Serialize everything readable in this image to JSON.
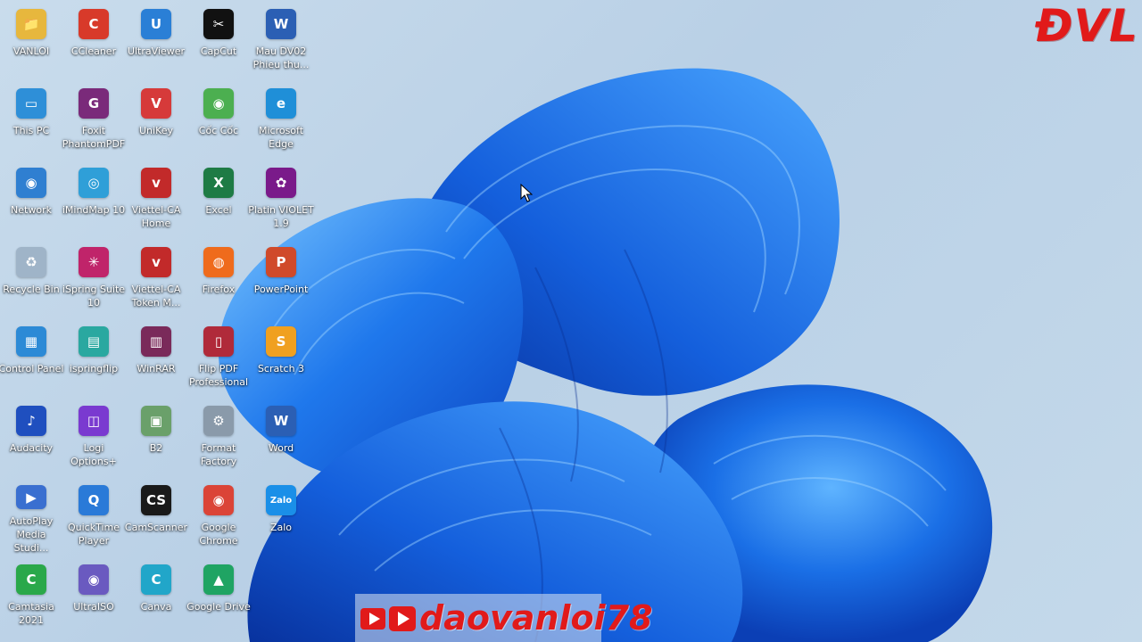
{
  "desktop": {
    "icons": [
      {
        "label": "VANLOI",
        "glyph": "📁",
        "color": "#e7b73d"
      },
      {
        "label": "This PC",
        "glyph": "▭",
        "color": "#2e8fd8"
      },
      {
        "label": "Network",
        "glyph": "◉",
        "color": "#2f7fd1"
      },
      {
        "label": "Recycle Bin",
        "glyph": "♻",
        "color": "#9fb4c8"
      },
      {
        "label": "Control Panel",
        "glyph": "▦",
        "color": "#2c8ad6"
      },
      {
        "label": "Audacity",
        "glyph": "♪",
        "color": "#1f4fbf"
      },
      {
        "label": "AutoPlay Media Studi...",
        "glyph": "▶",
        "color": "#3a6fd0"
      },
      {
        "label": "Camtasia 2021",
        "glyph": "C",
        "color": "#2aa84a"
      },
      {
        "label": "CCleaner",
        "glyph": "C",
        "color": "#d83a2a"
      },
      {
        "label": "Foxit PhantomPDF",
        "glyph": "G",
        "color": "#7a2a7a"
      },
      {
        "label": "iMindMap 10",
        "glyph": "◎",
        "color": "#2f9fd8"
      },
      {
        "label": "iSpring Suite 10",
        "glyph": "✳",
        "color": "#c0246a"
      },
      {
        "label": "ispringflip",
        "glyph": "▤",
        "color": "#2aa8a0"
      },
      {
        "label": "Logi Options+",
        "glyph": "◫",
        "color": "#7a3ad0"
      },
      {
        "label": "QuickTime Player",
        "glyph": "Q",
        "color": "#2a7ad8"
      },
      {
        "label": "UltraISO",
        "glyph": "◉",
        "color": "#6a5ac0"
      },
      {
        "label": "UltraViewer",
        "glyph": "U",
        "color": "#2a7fd6"
      },
      {
        "label": "UniKey",
        "glyph": "V",
        "color": "#d63a3a"
      },
      {
        "label": "Viettel-CA Home",
        "glyph": "v",
        "color": "#c22a2a"
      },
      {
        "label": "Viettel-CA Token M...",
        "glyph": "v",
        "color": "#c22a2a"
      },
      {
        "label": "WinRAR",
        "glyph": "▥",
        "color": "#7a2a5a"
      },
      {
        "label": "B2",
        "glyph": "▣",
        "color": "#6aa06a"
      },
      {
        "label": "CamScanner",
        "glyph": "CS",
        "color": "#1a1a1a"
      },
      {
        "label": "Canva",
        "glyph": "C",
        "color": "#21a6c9"
      },
      {
        "label": "CapCut",
        "glyph": "✂",
        "color": "#111111"
      },
      {
        "label": "Cốc Cốc",
        "glyph": "◉",
        "color": "#4caf50"
      },
      {
        "label": "Excel",
        "glyph": "X",
        "color": "#1e7b45"
      },
      {
        "label": "Firefox",
        "glyph": "◍",
        "color": "#ef6b1c"
      },
      {
        "label": "Flip PDF Professional",
        "glyph": "▯",
        "color": "#b02a3a"
      },
      {
        "label": "Format Factory",
        "glyph": "⚙",
        "color": "#8a9aaa"
      },
      {
        "label": "Google Chrome",
        "glyph": "◉",
        "color": "#db4437"
      },
      {
        "label": "Google Drive",
        "glyph": "▲",
        "color": "#1fa463"
      },
      {
        "label": "Mau DV02 Phieu thu...",
        "glyph": "W",
        "color": "#2b5fb4"
      },
      {
        "label": "Microsoft Edge",
        "glyph": "e",
        "color": "#1f8fd8"
      },
      {
        "label": "Platin VIOLET 1.9",
        "glyph": "✿",
        "color": "#7a1a8a"
      },
      {
        "label": "PowerPoint",
        "glyph": "P",
        "color": "#d04a2a"
      },
      {
        "label": "Scratch 3",
        "glyph": "S",
        "color": "#f0a020"
      },
      {
        "label": "Word",
        "glyph": "W",
        "color": "#2b5fb4"
      },
      {
        "label": "Zalo",
        "glyph": "Zalo",
        "color": "#1a8fe8"
      }
    ]
  },
  "branding": {
    "logo_text": "ĐVL",
    "youtube_handle": "daovanloi78",
    "youtube_badge_text": "YouTube"
  }
}
